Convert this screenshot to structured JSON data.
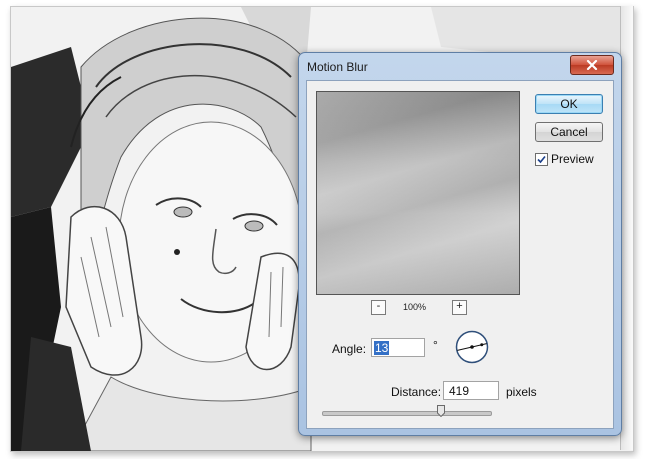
{
  "dialog": {
    "title": "Motion Blur",
    "ok_label": "OK",
    "cancel_label": "Cancel",
    "preview_label": "Preview",
    "preview_checked": true,
    "zoom_minus": "-",
    "zoom_plus": "+",
    "zoom_level": "100%",
    "angle_label": "Angle:",
    "angle_value": "13",
    "degree_symbol": "°",
    "distance_label": "Distance:",
    "distance_value": "419",
    "distance_unit": "pixels",
    "distance_slider_fraction": 0.71
  },
  "icons": {
    "close": "close-icon",
    "checkbox": "checkmark-icon",
    "dial": "angle-dial-icon"
  },
  "colors": {
    "ok_accent": "#3c7fb1",
    "close_red": "#c7432c",
    "selection": "#3470c6"
  }
}
